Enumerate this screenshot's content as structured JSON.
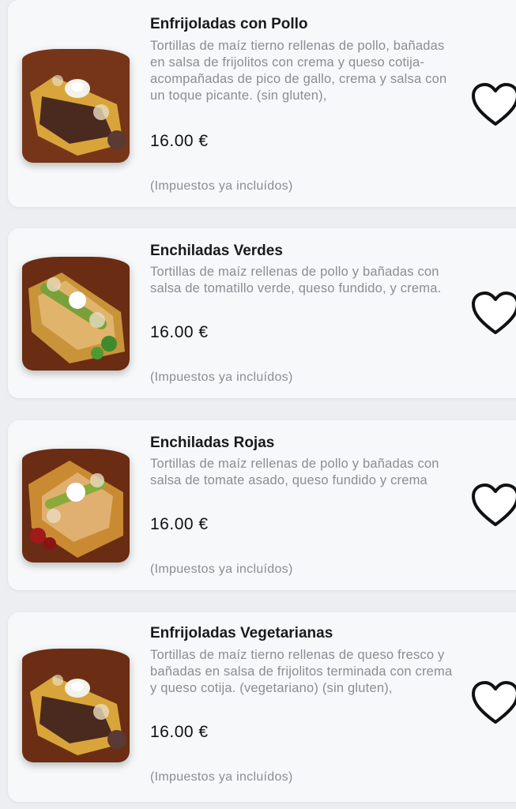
{
  "items": [
    {
      "title": "Enfrijoladas con Pollo",
      "description": "Tortillas de maíz tierno rellenas de pollo, bañadas en salsa de frijolitos con crema y queso cotija- acompañadas de pico de gallo, crema y salsa con un toque picante. (sin gluten),",
      "price": "16.00 €",
      "tax_note": "(Impuestos ya incluídos)",
      "image": "enfrijoladas-dish",
      "favorite_icon": "heart-outline-icon"
    },
    {
      "title": "Enchiladas Verdes",
      "description": "Tortillas de maíz rellenas de pollo y bañadas con salsa de tomatillo verde, queso fundido, y crema.",
      "price": "16.00 €",
      "tax_note": "(Impuestos ya incluídos)",
      "image": "enchiladas-verdes-dish",
      "favorite_icon": "heart-outline-icon"
    },
    {
      "title": "Enchiladas Rojas",
      "description": "Tortillas de maíz rellenas de pollo y bañadas con salsa de tomate asado, queso fundido y crema",
      "price": "16.00 €",
      "tax_note": "(Impuestos ya incluídos)",
      "image": "enchiladas-rojas-dish",
      "favorite_icon": "heart-outline-icon"
    },
    {
      "title": "Enfrijoladas Vegetarianas",
      "description": "Tortillas de maíz tierno rellenas de queso fresco y bañadas en salsa de frijolitos terminada con crema y queso cotija. (vegetariano) (sin gluten),",
      "price": "16.00 €",
      "tax_note": "(Impuestos ya incluídos)",
      "image": "enfrijoladas-dish",
      "favorite_icon": "heart-outline-icon"
    }
  ],
  "colors": {
    "title": "#1a1a1a",
    "muted": "#8a8d93",
    "card": "#f7f8fa",
    "background": "#eceef2"
  }
}
